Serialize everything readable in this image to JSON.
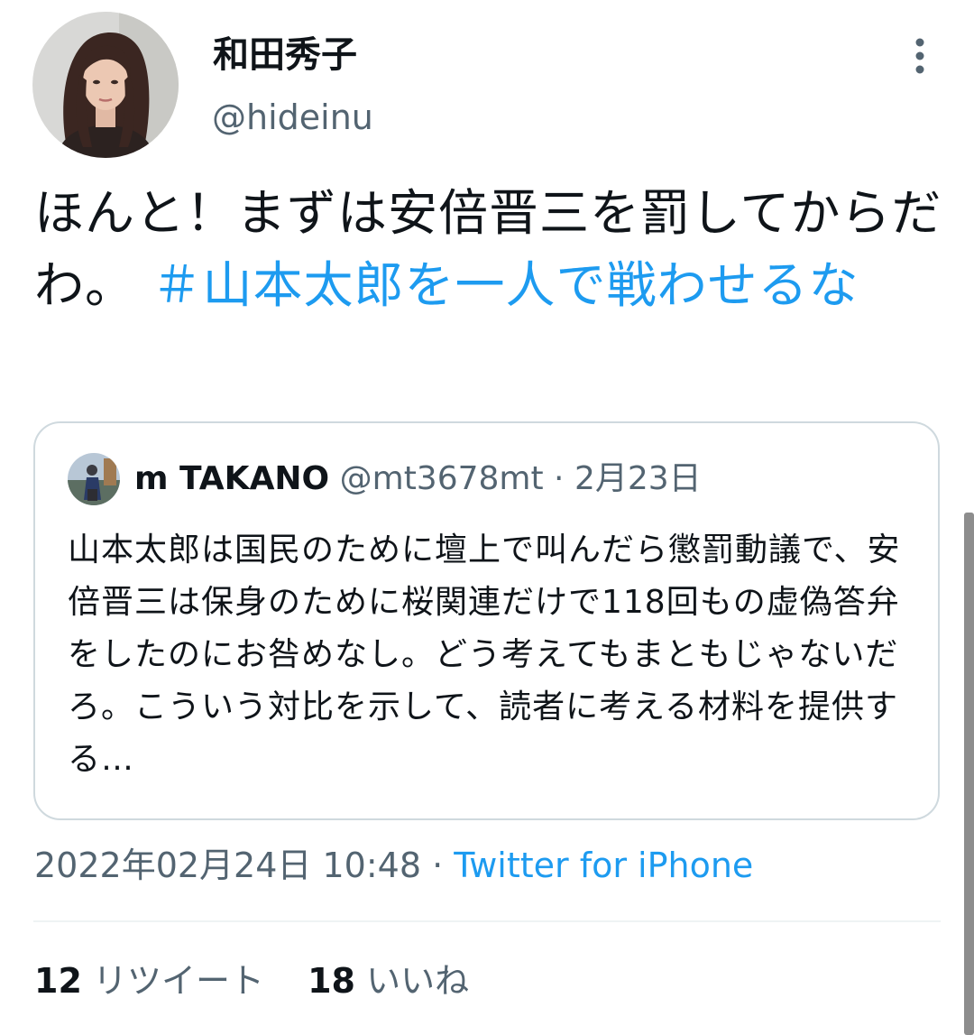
{
  "author": {
    "name": "和田秀子",
    "handle": "@hideinu"
  },
  "tweet": {
    "text": "ほんと！まずは安倍晋三を罰してからだわ。",
    "hashtag": "＃山本太郎を一人で戦わせるな"
  },
  "quoted_tweet": {
    "name": "m TAKANO",
    "handle": "@mt3678mt",
    "separator": " · ",
    "date": "2月23日",
    "text": "山本太郎は国民のために壇上で叫んだら懲罰動議で、安倍晋三は保身のために桜関連だけで118回もの虚偽答弁をしたのにお咎めなし。どう考えてもまともじゃないだろ。こういう対比を示して、読者に考える材料を提供する…"
  },
  "meta": {
    "timestamp": "2022年02月24日 10:48",
    "separator": " · ",
    "source": "Twitter for iPhone"
  },
  "stats": {
    "retweet_count": "12",
    "retweet_label": "リツイート",
    "like_count": "18",
    "like_label": "いいね"
  },
  "icons": {
    "more": "more-vertical-icon"
  },
  "colors": {
    "link": "#1d9bf0",
    "secondary_text": "#536471",
    "primary_text": "#0f1419",
    "border": "#cfd9de"
  }
}
